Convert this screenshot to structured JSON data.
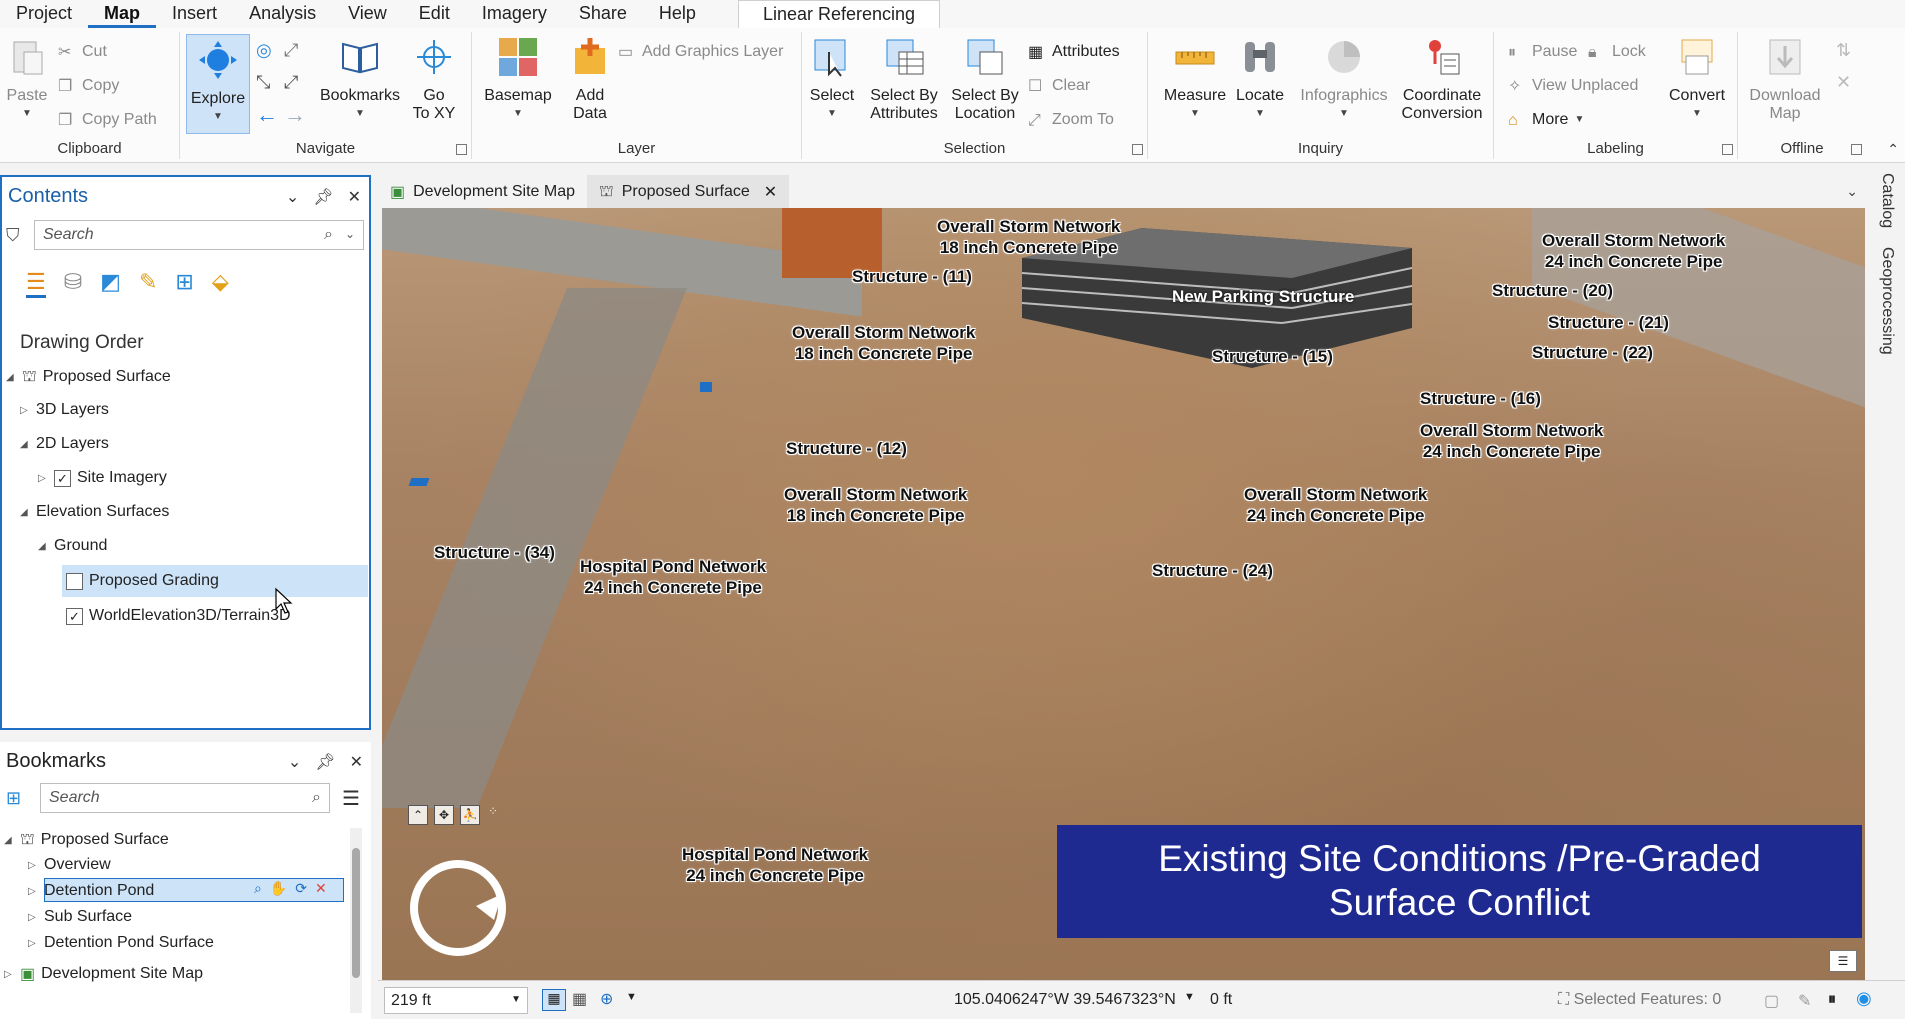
{
  "ribbon_tabs": [
    "Project",
    "Map",
    "Insert",
    "Analysis",
    "View",
    "Edit",
    "Imagery",
    "Share",
    "Help"
  ],
  "active_tab": "Map",
  "context_tab": "Linear Referencing",
  "clipboard": {
    "label": "Clipboard",
    "paste": "Paste",
    "cut": "Cut",
    "copy": "Copy",
    "copy_path": "Copy Path"
  },
  "navigate": {
    "label": "Navigate",
    "explore": "Explore",
    "bookmarks": "Bookmarks",
    "go_to_xy": "Go\nTo XY"
  },
  "layer": {
    "label": "Layer",
    "basemap": "Basemap",
    "add_data": "Add\nData",
    "add_graphics_layer": "Add Graphics Layer"
  },
  "selection": {
    "label": "Selection",
    "select": "Select",
    "select_by_attributes": "Select By\nAttributes",
    "select_by_location": "Select By\nLocation",
    "attributes": "Attributes",
    "clear": "Clear",
    "zoom_to": "Zoom To"
  },
  "inquiry": {
    "label": "Inquiry",
    "measure": "Measure",
    "locate": "Locate",
    "infographics": "Infographics",
    "coordinate_conversion": "Coordinate\nConversion"
  },
  "labeling": {
    "label": "Labeling",
    "pause": "Pause",
    "lock": "Lock",
    "view_unplaced": "View Unplaced",
    "more": "More",
    "convert": "Convert"
  },
  "offline": {
    "label": "Offline",
    "download_map": "Download\nMap"
  },
  "contents": {
    "title": "Contents",
    "search_placeholder": "Search",
    "drawing_order": "Drawing Order",
    "items": {
      "proposed_surface": "Proposed Surface",
      "layers_3d": "3D Layers",
      "layers_2d": "2D Layers",
      "site_imagery": "Site Imagery",
      "elevation_surfaces": "Elevation Surfaces",
      "ground": "Ground",
      "proposed_grading": "Proposed Grading",
      "world_elevation": "WorldElevation3D/Terrain3D"
    }
  },
  "bookmarks_pane": {
    "title": "Bookmarks",
    "search_placeholder": "Search",
    "items": {
      "proposed_surface": "Proposed Surface",
      "overview": "Overview",
      "detention_pond": "Detention Pond",
      "sub_surface": "Sub Surface",
      "detention_pond_surface": "Detention Pond Surface",
      "development_site_map": "Development Site Map"
    }
  },
  "doc_tabs": [
    "Development Site Map",
    "Proposed Surface"
  ],
  "map_labels": {
    "l1": "Overall Storm Network\n18 inch Concrete Pipe",
    "l2": "Structure - (11)",
    "l3": "New Parking Structure",
    "l4": "Overall Storm Network\n24 inch Concrete Pipe",
    "l5": "Structure - (20)",
    "l6": "Structure - (21)",
    "l7": "Structure - (22)",
    "l8": "Structure - (15)",
    "l9": "Overall Storm Network\n18 inch Concrete Pipe",
    "l10": "Structure - (16)",
    "l11": "Overall Storm Network\n24 inch Concrete Pipe",
    "l12": "Structure - (12)",
    "l13": "Overall Storm Network\n18 inch Concrete Pipe",
    "l14": "Overall Storm Network\n24 inch Concrete Pipe",
    "l15": "Structure - (34)",
    "l16": "Hospital Pond Network\n24 inch Concrete Pipe",
    "l17": "Structure - (24)",
    "l18": "Hospital Pond Network\n24 inch Concrete Pipe"
  },
  "banner": "Existing Site Conditions /Pre-Graded\nSurface Conflict",
  "right_dock": [
    "Catalog",
    "Geoprocessing"
  ],
  "status": {
    "scale": "219 ft",
    "coordinates": "105.0406247°W 39.5467323°N",
    "elevation": "0 ft",
    "selected_features": "Selected Features: 0"
  },
  "colors": {
    "accent": "#1f6fc5",
    "banner": "#1f2a91",
    "selected_row": "#cde3f7"
  }
}
